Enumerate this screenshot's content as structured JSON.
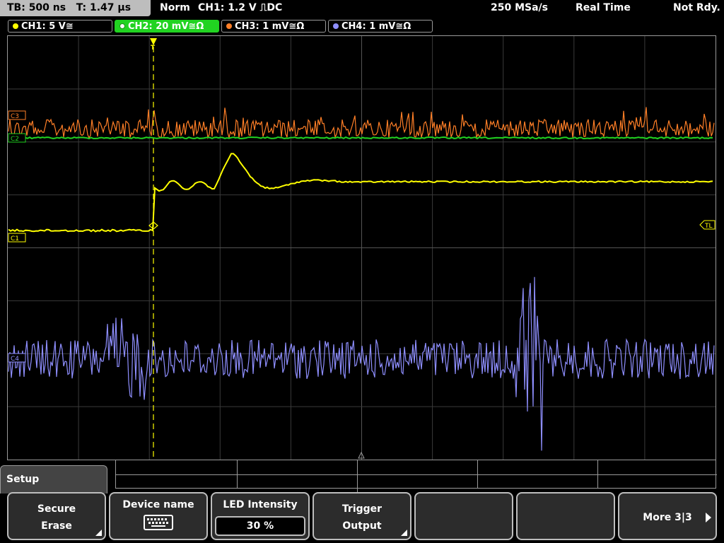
{
  "status": {
    "timebase": "TB: 500 ns",
    "trigger_time": "T: 1.47 µs",
    "trigger_mode": "Norm",
    "trigger_source": "CH1: 1.2 V ⎍DC",
    "sample_rate": "250 MSa/s",
    "acq_mode": "Real Time",
    "state": "Not Rdy."
  },
  "channels": [
    {
      "label": "CH1: 5 V≅",
      "color": "#ffff00"
    },
    {
      "label": "CH2: 20 mV≅Ω",
      "color": "#21d321"
    },
    {
      "label": "CH3: 1 mV≅Ω",
      "color": "#ff7f27"
    },
    {
      "label": "CH4: 1 mV≅Ω",
      "color": "#8f8fff"
    }
  ],
  "markers": {
    "ch1": "C1",
    "ch2": "C2",
    "ch3": "C3",
    "ch4": "C4",
    "trigger_level": "TL",
    "trigger_pos": "T"
  },
  "menu": {
    "title": "Setup",
    "softkeys": [
      {
        "line1": "Secure",
        "line2": "Erase"
      },
      {
        "line1": "Device name",
        "icon": "keyboard-icon"
      },
      {
        "line1": "LED Intensity",
        "value": "30 %"
      },
      {
        "line1": "Trigger",
        "line2": "Output"
      },
      {
        "line1": ""
      },
      {
        "line1": ""
      },
      {
        "line1": "More 3|3"
      }
    ]
  }
}
